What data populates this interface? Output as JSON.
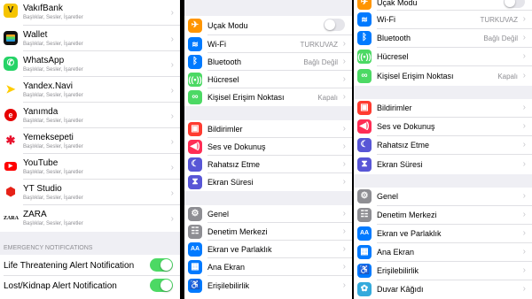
{
  "panel1": {
    "apps": [
      {
        "name": "VakıfBank",
        "sub": "Başlıklar, Sesler, İşaretler",
        "icon": "vakifbank-icon",
        "color": "#f5c400"
      },
      {
        "name": "Wallet",
        "sub": "Başlıklar, Sesler, İşaretler",
        "icon": "wallet-icon",
        "color": "#111111"
      },
      {
        "name": "WhatsApp",
        "sub": "Başlıklar, Sesler, İşaretler",
        "icon": "whatsapp-icon",
        "color": "#25d366"
      },
      {
        "name": "Yandex.Navi",
        "sub": "Başlıklar, Sesler, İşaretler",
        "icon": "yandex-navi-icon",
        "color": "#ffffff"
      },
      {
        "name": "Yanımda",
        "sub": "Başlıklar, Sesler, İşaretler",
        "icon": "yanimda-icon",
        "color": "#e60000"
      },
      {
        "name": "Yemeksepeti",
        "sub": "Başlıklar, Sesler, İşaretler",
        "icon": "yemeksepeti-icon",
        "color": "#e8112d"
      },
      {
        "name": "YouTube",
        "sub": "Başlıklar, Sesler, İşaretler",
        "icon": "youtube-icon",
        "color": "#ffffff"
      },
      {
        "name": "YT Studio",
        "sub": "Başlıklar, Sesler, İşaretler",
        "icon": "yt-studio-icon",
        "color": "#ffffff"
      },
      {
        "name": "ZARA",
        "sub": "Başlıklar, Sesler, İşaretler",
        "icon": "zara-icon",
        "color": "#ffffff"
      }
    ],
    "emergency_header": "EMERGENCY NOTIFICATIONS",
    "emergency": [
      {
        "label": "Life Threatening Alert Notification",
        "on": true
      },
      {
        "label": "Lost/Kidnap Alert Notification",
        "on": true
      }
    ]
  },
  "panel2": {
    "airplane": "Uçak Modu",
    "wifi": "Wi-Fi",
    "wifi_value": "TURKUVAZ",
    "bluetooth": "Bluetooth",
    "bluetooth_value": "Bağlı Değil",
    "cellular": "Hücresel",
    "hotspot": "Kişisel Erişim Noktası",
    "hotspot_value": "Kapalı",
    "notifications": "Bildirimler",
    "sounds": "Ses ve Dokunuş",
    "dnd": "Rahatsız Etme",
    "screentime": "Ekran Süresi",
    "general": "Genel",
    "control_center": "Denetim Merkezi",
    "display": "Ekran ve Parlaklık",
    "home_screen": "Ana Ekran",
    "accessibility": "Erişilebilirlik"
  },
  "panel3": {
    "airplane": "Uçak Modu",
    "wifi": "Wi-Fi",
    "wifi_value": "TURKUVAZ",
    "bluetooth": "Bluetooth",
    "bluetooth_value": "Bağlı Değil",
    "cellular": "Hücresel",
    "hotspot": "Kişisel Erişim Noktası",
    "hotspot_value": "Kapalı",
    "notifications": "Bildirimler",
    "sounds": "Ses ve Dokunuş",
    "dnd": "Rahatsız Etme",
    "screentime": "Ekran Süresi",
    "general": "Genel",
    "control_center": "Denetim Merkezi",
    "display": "Ekran ve Parlaklık",
    "accessibility": "Erişilebilirlik",
    "wallpaper": "Duvar Kâğıdı"
  }
}
